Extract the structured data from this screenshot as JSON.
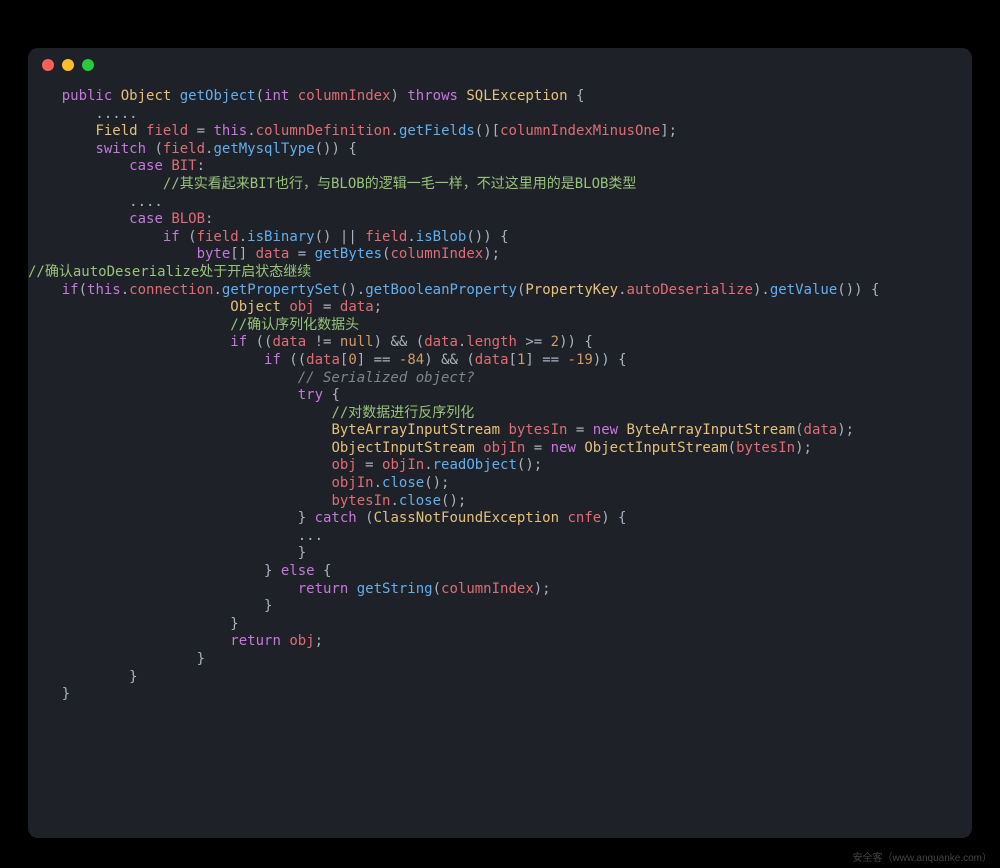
{
  "watermark": "安全客（www.anquanke.com）",
  "code": [
    [
      [
        "c-pun",
        "    "
      ],
      [
        "c-key",
        "public"
      ],
      [
        "c-pun",
        " "
      ],
      [
        "c-type",
        "Object"
      ],
      [
        "c-pun",
        " "
      ],
      [
        "c-fn",
        "getObject"
      ],
      [
        "c-pun",
        "("
      ],
      [
        "c-key",
        "int"
      ],
      [
        "c-pun",
        " "
      ],
      [
        "c-id",
        "columnIndex"
      ],
      [
        "c-pun",
        ") "
      ],
      [
        "c-key",
        "throws"
      ],
      [
        "c-pun",
        " "
      ],
      [
        "c-type",
        "SQLException"
      ],
      [
        "c-pun",
        " {"
      ]
    ],
    [
      [
        "c-pun",
        "        ....."
      ]
    ],
    [
      [
        "c-pun",
        ""
      ]
    ],
    [
      [
        "c-pun",
        "        "
      ],
      [
        "c-type",
        "Field"
      ],
      [
        "c-pun",
        " "
      ],
      [
        "c-id",
        "field"
      ],
      [
        "c-pun",
        " = "
      ],
      [
        "c-key",
        "this"
      ],
      [
        "c-pun",
        "."
      ],
      [
        "c-id",
        "columnDefinition"
      ],
      [
        "c-pun",
        "."
      ],
      [
        "c-fn",
        "getFields"
      ],
      [
        "c-pun",
        "()["
      ],
      [
        "c-id",
        "columnIndexMinusOne"
      ],
      [
        "c-pun",
        "];"
      ]
    ],
    [
      [
        "c-pun",
        "        "
      ],
      [
        "c-key",
        "switch"
      ],
      [
        "c-pun",
        " ("
      ],
      [
        "c-id",
        "field"
      ],
      [
        "c-pun",
        "."
      ],
      [
        "c-fn",
        "getMysqlType"
      ],
      [
        "c-pun",
        "()) {"
      ]
    ],
    [
      [
        "c-pun",
        "            "
      ],
      [
        "c-key",
        "case"
      ],
      [
        "c-pun",
        " "
      ],
      [
        "c-id",
        "BIT"
      ],
      [
        "c-pun",
        ":"
      ]
    ],
    [
      [
        "c-pun",
        "                "
      ],
      [
        "c-cmt-cn",
        "//其实看起来BIT也行，与BLOB的逻辑一毛一样，不过这里用的是BLOB类型"
      ]
    ],
    [
      [
        "c-pun",
        "            ...."
      ]
    ],
    [
      [
        "c-pun",
        "            "
      ],
      [
        "c-key",
        "case"
      ],
      [
        "c-pun",
        " "
      ],
      [
        "c-id",
        "BLOB"
      ],
      [
        "c-pun",
        ":"
      ]
    ],
    [
      [
        "c-pun",
        "                "
      ],
      [
        "c-key",
        "if"
      ],
      [
        "c-pun",
        " ("
      ],
      [
        "c-id",
        "field"
      ],
      [
        "c-pun",
        "."
      ],
      [
        "c-fn",
        "isBinary"
      ],
      [
        "c-pun",
        "() || "
      ],
      [
        "c-id",
        "field"
      ],
      [
        "c-pun",
        "."
      ],
      [
        "c-fn",
        "isBlob"
      ],
      [
        "c-pun",
        "()) {"
      ]
    ],
    [
      [
        "c-pun",
        "                    "
      ],
      [
        "c-key",
        "byte"
      ],
      [
        "c-pun",
        "[] "
      ],
      [
        "c-id",
        "data"
      ],
      [
        "c-pun",
        " = "
      ],
      [
        "c-fn",
        "getBytes"
      ],
      [
        "c-pun",
        "("
      ],
      [
        "c-id",
        "columnIndex"
      ],
      [
        "c-pun",
        ");"
      ]
    ],
    [
      [
        "c-cmt-cn",
        "//确认autoDeserialize处于开启状态继续"
      ]
    ],
    [
      [
        "c-pun",
        ""
      ]
    ],
    [
      [
        "c-pun",
        "    "
      ],
      [
        "c-key",
        "if"
      ],
      [
        "c-pun",
        "("
      ],
      [
        "c-key",
        "this"
      ],
      [
        "c-pun",
        "."
      ],
      [
        "c-id",
        "connection"
      ],
      [
        "c-pun",
        "."
      ],
      [
        "c-fn",
        "getPropertySet"
      ],
      [
        "c-pun",
        "()."
      ],
      [
        "c-fn",
        "getBooleanProperty"
      ],
      [
        "c-pun",
        "("
      ],
      [
        "c-type",
        "PropertyKey"
      ],
      [
        "c-pun",
        "."
      ],
      [
        "c-id",
        "autoDeserialize"
      ],
      [
        "c-pun",
        ")."
      ],
      [
        "c-fn",
        "getValue"
      ],
      [
        "c-pun",
        "()) {"
      ]
    ],
    [
      [
        "c-pun",
        "                        "
      ],
      [
        "c-type",
        "Object"
      ],
      [
        "c-pun",
        " "
      ],
      [
        "c-id",
        "obj"
      ],
      [
        "c-pun",
        " = "
      ],
      [
        "c-id",
        "data"
      ],
      [
        "c-pun",
        ";"
      ]
    ],
    [
      [
        "c-pun",
        "                        "
      ],
      [
        "c-cmt-cn",
        "//确认序列化数据头"
      ]
    ],
    [
      [
        "c-pun",
        "                        "
      ],
      [
        "c-key",
        "if"
      ],
      [
        "c-pun",
        " (("
      ],
      [
        "c-id",
        "data"
      ],
      [
        "c-pun",
        " != "
      ],
      [
        "c-num",
        "null"
      ],
      [
        "c-pun",
        ") && ("
      ],
      [
        "c-id",
        "data"
      ],
      [
        "c-pun",
        "."
      ],
      [
        "c-id",
        "length"
      ],
      [
        "c-pun",
        " >= "
      ],
      [
        "c-num",
        "2"
      ],
      [
        "c-pun",
        ")) {"
      ]
    ],
    [
      [
        "c-pun",
        "                            "
      ],
      [
        "c-key",
        "if"
      ],
      [
        "c-pun",
        " (("
      ],
      [
        "c-id",
        "data"
      ],
      [
        "c-pun",
        "["
      ],
      [
        "c-num",
        "0"
      ],
      [
        "c-pun",
        "] == "
      ],
      [
        "c-num",
        "-84"
      ],
      [
        "c-pun",
        ") && ("
      ],
      [
        "c-id",
        "data"
      ],
      [
        "c-pun",
        "["
      ],
      [
        "c-num",
        "1"
      ],
      [
        "c-pun",
        "] == "
      ],
      [
        "c-num",
        "-19"
      ],
      [
        "c-pun",
        ")) {"
      ]
    ],
    [
      [
        "c-pun",
        "                                "
      ],
      [
        "c-cmt",
        "// Serialized object?"
      ]
    ],
    [
      [
        "c-pun",
        "                                "
      ],
      [
        "c-key",
        "try"
      ],
      [
        "c-pun",
        " {"
      ]
    ],
    [
      [
        "c-pun",
        "                                    "
      ],
      [
        "c-cmt-cn",
        "//对数据进行反序列化"
      ]
    ],
    [
      [
        "c-pun",
        "                                    "
      ],
      [
        "c-type",
        "ByteArrayInputStream"
      ],
      [
        "c-pun",
        " "
      ],
      [
        "c-id",
        "bytesIn"
      ],
      [
        "c-pun",
        " = "
      ],
      [
        "c-key",
        "new"
      ],
      [
        "c-pun",
        " "
      ],
      [
        "c-type",
        "ByteArrayInputStream"
      ],
      [
        "c-pun",
        "("
      ],
      [
        "c-id",
        "data"
      ],
      [
        "c-pun",
        ");"
      ]
    ],
    [
      [
        "c-pun",
        "                                    "
      ],
      [
        "c-type",
        "ObjectInputStream"
      ],
      [
        "c-pun",
        " "
      ],
      [
        "c-id",
        "objIn"
      ],
      [
        "c-pun",
        " = "
      ],
      [
        "c-key",
        "new"
      ],
      [
        "c-pun",
        " "
      ],
      [
        "c-type",
        "ObjectInputStream"
      ],
      [
        "c-pun",
        "("
      ],
      [
        "c-id",
        "bytesIn"
      ],
      [
        "c-pun",
        ");"
      ]
    ],
    [
      [
        "c-pun",
        "                                    "
      ],
      [
        "c-id",
        "obj"
      ],
      [
        "c-pun",
        " = "
      ],
      [
        "c-id",
        "objIn"
      ],
      [
        "c-pun",
        "."
      ],
      [
        "c-fn",
        "readObject"
      ],
      [
        "c-pun",
        "();"
      ]
    ],
    [
      [
        "c-pun",
        "                                    "
      ],
      [
        "c-id",
        "objIn"
      ],
      [
        "c-pun",
        "."
      ],
      [
        "c-fn",
        "close"
      ],
      [
        "c-pun",
        "();"
      ]
    ],
    [
      [
        "c-pun",
        "                                    "
      ],
      [
        "c-id",
        "bytesIn"
      ],
      [
        "c-pun",
        "."
      ],
      [
        "c-fn",
        "close"
      ],
      [
        "c-pun",
        "();"
      ]
    ],
    [
      [
        "c-pun",
        "                                } "
      ],
      [
        "c-key",
        "catch"
      ],
      [
        "c-pun",
        " ("
      ],
      [
        "c-type",
        "ClassNotFoundException"
      ],
      [
        "c-pun",
        " "
      ],
      [
        "c-id",
        "cnfe"
      ],
      [
        "c-pun",
        ") {"
      ]
    ],
    [
      [
        "c-pun",
        "                                ..."
      ]
    ],
    [
      [
        "c-pun",
        "                                }"
      ]
    ],
    [
      [
        "c-pun",
        "                            } "
      ],
      [
        "c-key",
        "else"
      ],
      [
        "c-pun",
        " {"
      ]
    ],
    [
      [
        "c-pun",
        "                                "
      ],
      [
        "c-key",
        "return"
      ],
      [
        "c-pun",
        " "
      ],
      [
        "c-fn",
        "getString"
      ],
      [
        "c-pun",
        "("
      ],
      [
        "c-id",
        "columnIndex"
      ],
      [
        "c-pun",
        ");"
      ]
    ],
    [
      [
        "c-pun",
        "                            }"
      ]
    ],
    [
      [
        "c-pun",
        "                        }"
      ]
    ],
    [
      [
        "c-pun",
        ""
      ]
    ],
    [
      [
        "c-pun",
        "                        "
      ],
      [
        "c-key",
        "return"
      ],
      [
        "c-pun",
        " "
      ],
      [
        "c-id",
        "obj"
      ],
      [
        "c-pun",
        ";"
      ]
    ],
    [
      [
        "c-pun",
        "                    }"
      ]
    ],
    [
      [
        "c-pun",
        ""
      ]
    ],
    [
      [
        "c-pun",
        "            }"
      ]
    ],
    [
      [
        "c-pun",
        ""
      ]
    ],
    [
      [
        "c-pun",
        "    }"
      ]
    ]
  ]
}
